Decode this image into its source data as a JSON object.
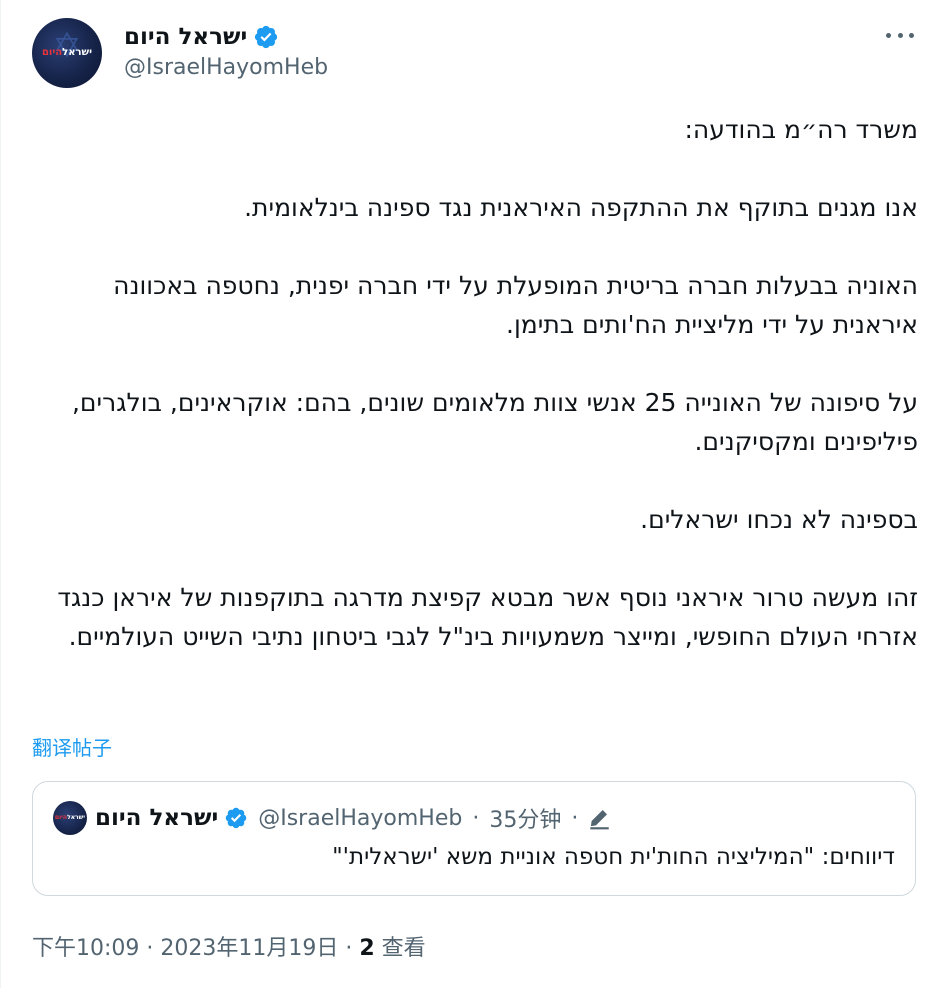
{
  "author": {
    "display_name": "ישראל היום",
    "handle": "@IsraelHayomHeb",
    "avatar_logo_white": "ישראל",
    "avatar_logo_red": "היום",
    "verified": "verified-badge-icon"
  },
  "tweet": {
    "paragraphs": [
      "משרד רה״מ בהודעה:",
      "אנו מגנים בתוקף את ההתקפה האיראנית נגד ספינה בינלאומית.",
      "האוניה בבעלות חברה בריטית המופעלת על ידי חברה יפנית, נחטפה באכוונה איראנית על ידי מליציית הח'ותים בתימן.",
      "על סיפונה של האונייה 25 אנשי צוות מלאומים שונים, בהם: אוקראינים, בולגרים, פיליפינים ומקסיקנים.",
      "בספינה לא נכחו ישראלים.",
      "זהו מעשה טרור איראני נוסף אשר מבטא קפיצת מדרגה בתוקפנות של איראן כנגד אזרחי העולם החופשי, ומייצר משמעויות בינ\"ל לגבי ביטחון נתיבי השייט העולמיים."
    ],
    "translate_label": "翻译帖子"
  },
  "quote": {
    "display_name": "ישראל היום",
    "handle": "@IsraelHayomHeb",
    "time": "35分钟",
    "separator": "·",
    "text": "דיווחים: \"המיליציה החות'ית חטפה אוניית משא 'ישראלית'\""
  },
  "footer": {
    "timestamp": "下午10:09 · 2023年11月19日",
    "separator": "·",
    "views_count": "2",
    "views_label": "查看"
  },
  "colors": {
    "text": "#0f1419",
    "secondary": "#536471",
    "link": "#1d9bf0",
    "verified": "#1d9bf0",
    "border": "#cfd9de",
    "brand_red": "#e8323c"
  }
}
